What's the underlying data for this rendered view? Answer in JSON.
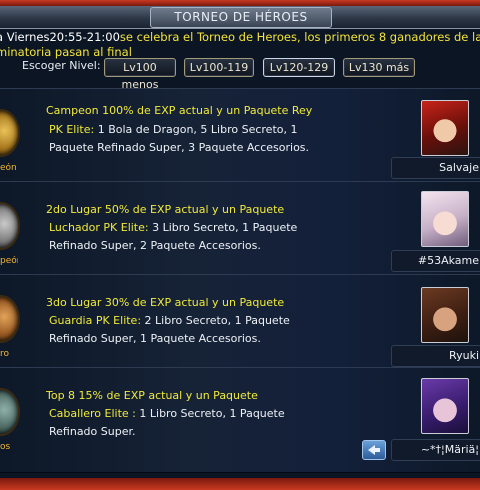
{
  "window": {
    "title": "TORNEO DE HÉROES"
  },
  "notice": {
    "line1_prefix": "a Viernes20:55-21:00",
    "line1_rest": "se celebra el Torneo de Heroes, los primeros 8 ganadores de la",
    "line2": "minatoria pasan al final"
  },
  "level_filter": {
    "label": "Escoger Nivel:",
    "options": [
      "Lv100 menos",
      "Lv100-119",
      "Lv120-129",
      "Lv130 más"
    ]
  },
  "ranks": [
    {
      "medal_label": "eón",
      "title": "Campeon  100% de EXP actual y un Paquete Rey",
      "line2": "PK Elite: 1 Bola de Dragon, 5 Libro Secreto, 1",
      "line3": "Paquete Refinado Super, 3 Paquete Accesorios.",
      "player": "Salvaje"
    },
    {
      "medal_label": "peón",
      "title": "2do Lugar 50% de EXP actual y un Paquete",
      "line2": "Luchador PK Elite: 3 Libro Secreto, 1 Paquete",
      "line3": "Refinado Super, 2 Paquete Accesorios.",
      "player": "#53Akame"
    },
    {
      "medal_label": "ro",
      "title": "3do Lugar 30% de EXP actual y un Paquete",
      "line2": "Guardia PK Elite: 2 Libro Secreto, 1 Paquete",
      "line3": "Refinado Super, 1 Paquete Accesorios.",
      "player": "Ryuki"
    },
    {
      "medal_label": "os",
      "title": "Top 8     15% de EXP actual y un Paquete",
      "line2": "Caballero Elite : 1 Libro Secreto, 1 Paquete",
      "line3": "Refinado Super.",
      "player": "~*†¦Märiä¦"
    }
  ],
  "colors": {
    "accent_yellow": "#f1ea3a",
    "frame_red": "#c83a22",
    "background": "#0b1524"
  }
}
